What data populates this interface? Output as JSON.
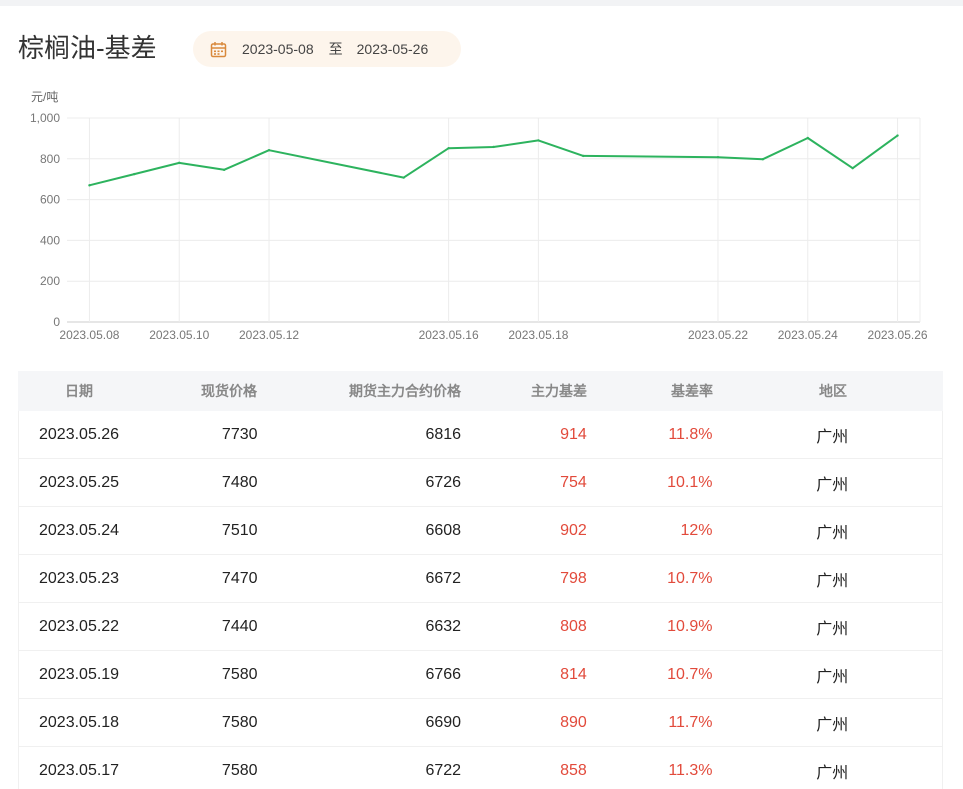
{
  "title": "棕榈油-基差",
  "date_range": {
    "start": "2023-05-08",
    "separator": "至",
    "end": "2023-05-26",
    "icon": "calendar-icon"
  },
  "colors": {
    "line": "#2db35e",
    "accent": "#e24a3b",
    "date_bg": "#fdf5ec",
    "calendar_icon": "#d9893c"
  },
  "chart_data": {
    "type": "line",
    "ylabel": "元/吨",
    "ylim": [
      0,
      1000
    ],
    "yticks": [
      "0",
      "200",
      "400",
      "600",
      "800",
      "1,000"
    ],
    "xticks": [
      "2023.05.08",
      "2023.05.10",
      "2023.05.12",
      "2023.05.16",
      "2023.05.18",
      "2023.05.22",
      "2023.05.24",
      "2023.05.26"
    ],
    "grid": true,
    "x": [
      "2023.05.08",
      "2023.05.09",
      "2023.05.10",
      "2023.05.11",
      "2023.05.12",
      "2023.05.15",
      "2023.05.16",
      "2023.05.17",
      "2023.05.18",
      "2023.05.19",
      "2023.05.22",
      "2023.05.23",
      "2023.05.24",
      "2023.05.25",
      "2023.05.26"
    ],
    "series": [
      {
        "values": [
          670,
          725,
          780,
          746,
          842,
          708,
          852,
          858,
          890,
          814,
          808,
          798,
          902,
          754,
          914
        ]
      }
    ]
  },
  "table": {
    "headers": [
      "日期",
      "现货价格",
      "期货主力合约价格",
      "主力基差",
      "基差率",
      "地区"
    ],
    "rows": [
      [
        "2023.05.26",
        "7730",
        "6816",
        "914",
        "11.8%",
        "广州"
      ],
      [
        "2023.05.25",
        "7480",
        "6726",
        "754",
        "10.1%",
        "广州"
      ],
      [
        "2023.05.24",
        "7510",
        "6608",
        "902",
        "12%",
        "广州"
      ],
      [
        "2023.05.23",
        "7470",
        "6672",
        "798",
        "10.7%",
        "广州"
      ],
      [
        "2023.05.22",
        "7440",
        "6632",
        "808",
        "10.9%",
        "广州"
      ],
      [
        "2023.05.19",
        "7580",
        "6766",
        "814",
        "10.7%",
        "广州"
      ],
      [
        "2023.05.18",
        "7580",
        "6690",
        "890",
        "11.7%",
        "广州"
      ],
      [
        "2023.05.17",
        "7580",
        "6722",
        "858",
        "11.3%",
        "广州"
      ]
    ]
  }
}
